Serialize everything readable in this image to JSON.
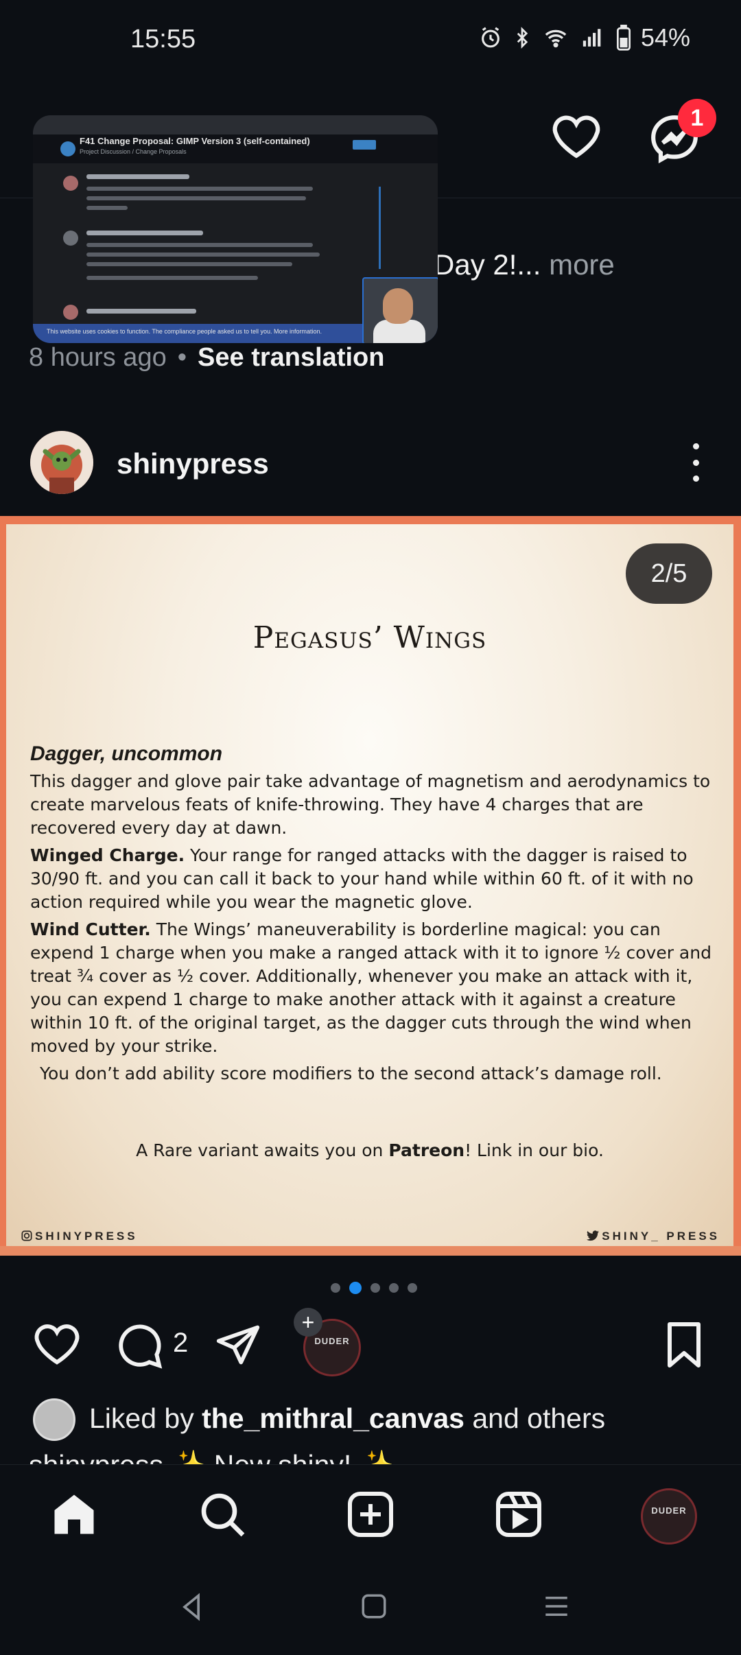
{
  "status_bar": {
    "time": "15:55",
    "battery": "54%",
    "icons": [
      "alarm-icon",
      "bluetooth-icon",
      "wifi-icon",
      "signal-icon",
      "battery-icon"
    ]
  },
  "header": {
    "notification_badge": "1"
  },
  "previous_post": {
    "caption_visible": "Day 2!...",
    "more_label": "more",
    "time_ago": "8 hours ago",
    "dot": "•",
    "see_translation": "See translation"
  },
  "pip_video": {
    "title": "F41 Change Proposal: GIMP Version 3 (self-contained)",
    "subtitle": "Project Discussion / Change Proposals",
    "cookie_banner": "This website uses cookies to function. The compliance people asked us to tell you. More information."
  },
  "post": {
    "username": "shinypress",
    "counter": "2/5",
    "card": {
      "title": "Pegasus’ Wings",
      "type_line": "Dagger, uncommon",
      "intro": "This dagger and glove pair take advantage of magnetism and aerodynamics to create marvelous feats of knife-throwing. They have 4 charges that are recovered every day at dawn.",
      "feature1_name": "Winged Charge.",
      "feature1_text": " Your range for ranged attacks with the dagger is raised to 30/90 ft. and you can call it back to your hand while within 60 ft. of it with no action required while you wear the magnetic glove.",
      "feature2_name": "Wind Cutter.",
      "feature2_text": " The Wings’ maneuverability is borderline magical: you can expend 1 charge when you make a ranged attack with it to ignore ½ cover and treat ¾ cover as ½ cover. Additionally, whenever you make an attack with it, you can expend 1 charge to make another attack with it against a creature within 10 ft. of the original target, as the dagger cuts through the wind when moved by your strike.",
      "note": "You don’t add ability score modifiers to the second attack’s damage roll.",
      "cta_prefix": "A Rare variant awaits you on ",
      "cta_bold": "Patreon",
      "cta_suffix": "! Link in our bio.",
      "handle_left": "SHINYPRESS",
      "handle_right": "SHINY_ PRESS"
    },
    "carousel": {
      "total": 5,
      "active_index": 1
    },
    "actions": {
      "comment_count": "2",
      "plus": "+",
      "mini_logo": "DUDER"
    },
    "liked_by_prefix": "Liked by ",
    "liked_by_user": "the_mithral_canvas",
    "liked_by_suffix": " and others",
    "caption_peek": "shinypress ✨ New shiny! ✨"
  },
  "bottom_nav": {
    "items": [
      "home-icon",
      "search-icon",
      "create-icon",
      "reels-icon",
      "profile-avatar"
    ]
  },
  "colors": {
    "background": "#0c0f14",
    "badge": "#ff2a3d",
    "active_dot": "#1d8cf0",
    "post_frame": "#ea7a54"
  }
}
